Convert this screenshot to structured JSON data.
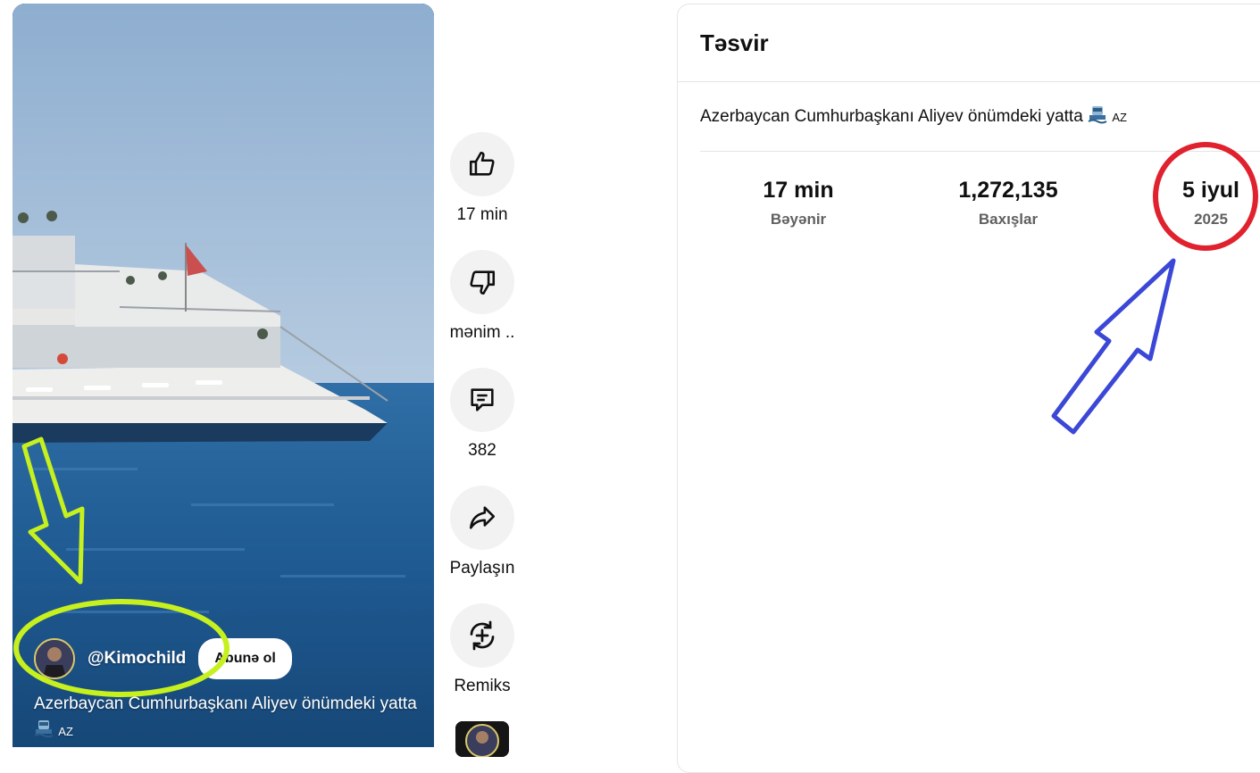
{
  "video": {
    "channel_handle": "@Kimochild",
    "subscribe_label": "Abunə ol",
    "caption": "Azerbaycan Cumhurbaşkanı Aliyev önümdeki yatta",
    "caption_tag": "AZ"
  },
  "actions": {
    "like_label": "17 min",
    "dislike_label": "mənim ..",
    "comments_label": "382",
    "share_label": "Paylaşın",
    "remix_label": "Remiks"
  },
  "description_panel": {
    "title": "Təsvir",
    "text": "Azerbaycan Cumhurbaşkanı Aliyev önümdeki yatta",
    "text_tag": "AZ",
    "stats": [
      {
        "value": "17 min",
        "label": "Bəyənir"
      },
      {
        "value": "1,272,135",
        "label": "Baxışlar"
      },
      {
        "value": "5 iyul",
        "label": "2025"
      }
    ]
  },
  "colors": {
    "annotation_green": "#c6f01e",
    "annotation_red": "#e0212e",
    "annotation_blue": "#3b47d6"
  }
}
